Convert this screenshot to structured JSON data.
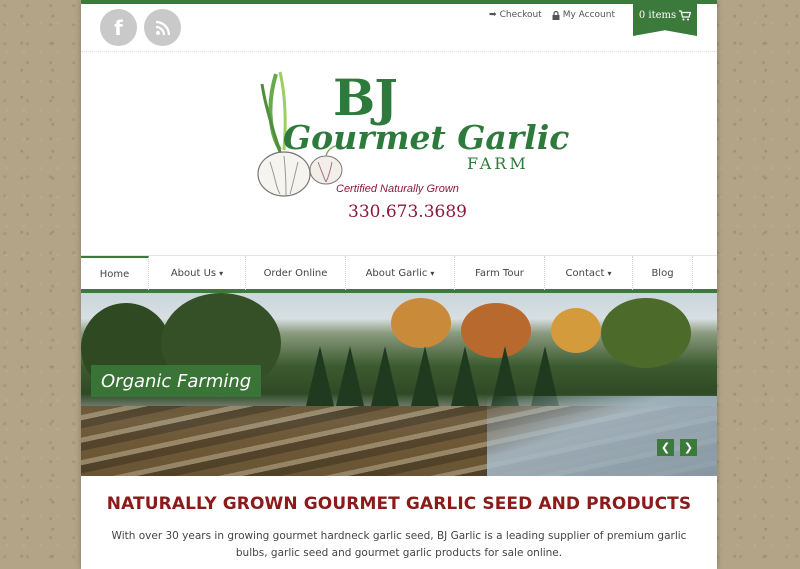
{
  "topbar": {
    "social": [
      {
        "name": "facebook-icon",
        "glyph": "f"
      },
      {
        "name": "rss-icon",
        "glyph": ""
      }
    ],
    "links": [
      {
        "label": "Checkout",
        "icon": "arrow-right-icon"
      },
      {
        "label": "My Account",
        "icon": "lock-icon"
      }
    ],
    "cart": {
      "label": "0 items",
      "icon": "cart-icon"
    }
  },
  "logo": {
    "line1": "BJ",
    "line2": "Gourmet Garlic",
    "line3": "FARM",
    "tagline": "Certified Naturally Grown",
    "phone": "330.673.3689",
    "brand_green": "#2e7a3c",
    "brand_maroon": "#8b1a3a"
  },
  "nav": {
    "items": [
      {
        "label": "Home",
        "active": true,
        "dropdown": false
      },
      {
        "label": "About Us",
        "active": false,
        "dropdown": true
      },
      {
        "label": "Order Online",
        "active": false,
        "dropdown": false
      },
      {
        "label": "About Garlic",
        "active": false,
        "dropdown": true
      },
      {
        "label": "Farm Tour",
        "active": false,
        "dropdown": false
      },
      {
        "label": "Contact",
        "active": false,
        "dropdown": true
      },
      {
        "label": "Blog",
        "active": false,
        "dropdown": false
      }
    ]
  },
  "hero": {
    "caption": "Organic Farming",
    "prev_icon": "chevron-left-icon",
    "next_icon": "chevron-right-icon"
  },
  "main": {
    "headline": "NATURALLY GROWN GOURMET GARLIC SEED AND PRODUCTS",
    "intro": "With over 30 years in growing gourmet hardneck garlic seed, BJ Garlic is a leading supplier of premium garlic bulbs, garlic seed and gourmet garlic products for sale online."
  }
}
